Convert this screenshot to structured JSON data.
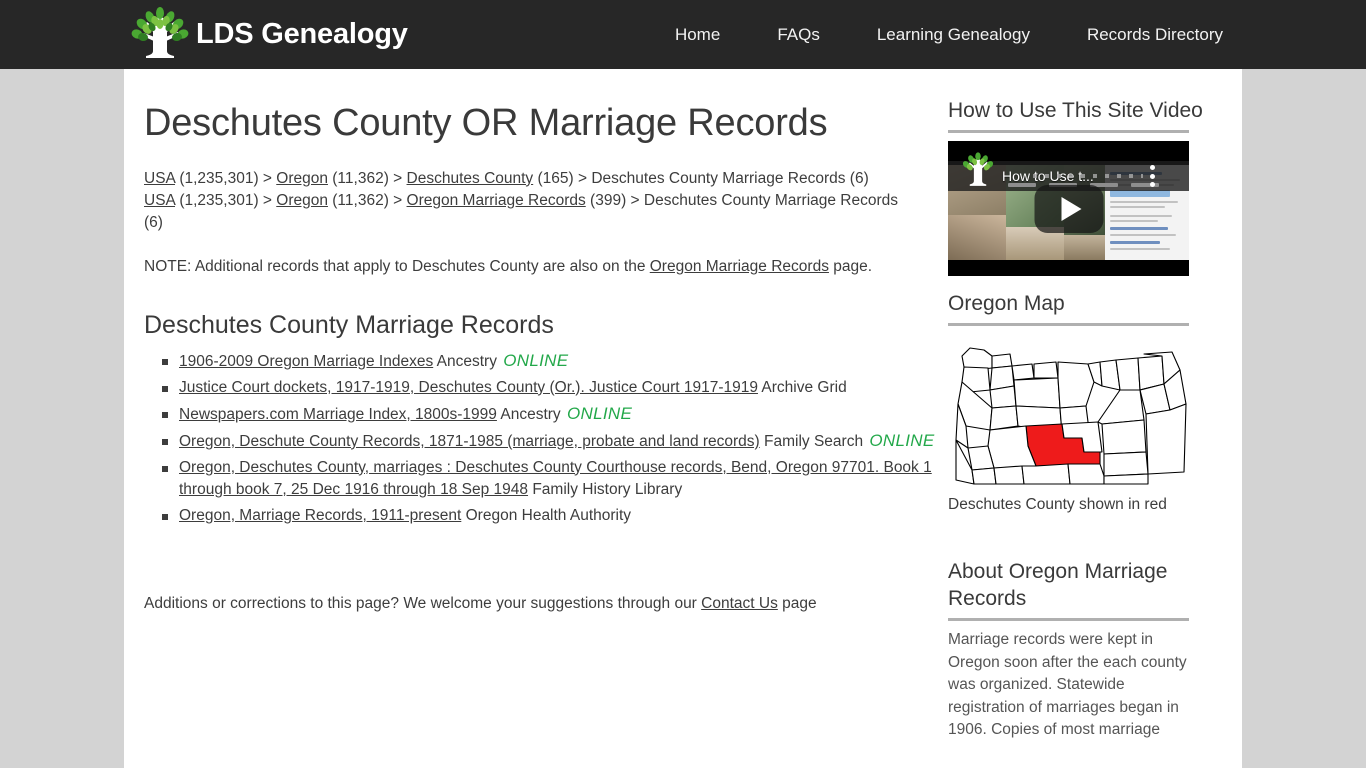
{
  "header": {
    "brand_name": "LDS Genealogy",
    "logo_icon": "family-tree-icon",
    "nav": [
      {
        "label": "Home"
      },
      {
        "label": "FAQs"
      },
      {
        "label": "Learning Genealogy"
      },
      {
        "label": "Records Directory"
      }
    ]
  },
  "main": {
    "page_title": "Deschutes County OR Marriage Records",
    "breadcrumb_1": [
      {
        "text": "USA",
        "link": true
      },
      {
        "text": " (1,235,301) > ",
        "link": false
      },
      {
        "text": "Oregon",
        "link": true
      },
      {
        "text": " (11,362) > ",
        "link": false
      },
      {
        "text": "Deschutes County",
        "link": true
      },
      {
        "text": " (165) > Deschutes County Marriage Records (6)",
        "link": false
      }
    ],
    "breadcrumb_2": [
      {
        "text": "USA",
        "link": true
      },
      {
        "text": " (1,235,301) > ",
        "link": false
      },
      {
        "text": "Oregon",
        "link": true
      },
      {
        "text": " (11,362) > ",
        "link": false
      },
      {
        "text": "Oregon Marriage Records",
        "link": true
      },
      {
        "text": " (399) > Deschutes County Marriage Records (6)",
        "link": false
      }
    ],
    "note_prefix": "NOTE: Additional records that apply to Deschutes County are also on the ",
    "note_link": "Oregon Marriage Records",
    "note_suffix": " page.",
    "section_title": "Deschutes County Marriage Records",
    "records": [
      {
        "link": "1906-2009 Oregon Marriage Indexes",
        "source": " Ancestry ",
        "badge": "ONLINE"
      },
      {
        "link": "Justice Court dockets, 1917-1919, Deschutes County (Or.). Justice Court 1917-1919",
        "source": " Archive Grid",
        "badge": ""
      },
      {
        "link": "Newspapers.com Marriage Index, 1800s-1999",
        "source": " Ancestry ",
        "badge": "ONLINE"
      },
      {
        "link": "Oregon, Deschute County Records, 1871-1985 (marriage, probate and land records)",
        "source": " Family Search ",
        "badge": "ONLINE"
      },
      {
        "link": "Oregon, Deschutes County, marriages : Deschutes County Courthouse records, Bend, Oregon 97701. Book 1 through book 7, 25 Dec 1916 through 18 Sep 1948",
        "source": " Family History Library",
        "badge": ""
      },
      {
        "link": "Oregon, Marriage Records, 1911-present",
        "source": " Oregon Health Authority",
        "badge": ""
      }
    ],
    "footer_prefix": "Additions or corrections to this page? We welcome your suggestions through our ",
    "footer_link": "Contact Us",
    "footer_suffix": " page"
  },
  "sidebar": {
    "video": {
      "heading": "How to Use This Site Video",
      "overlay_title": "How to Use t...",
      "play_icon": "play-button-icon",
      "menu_icon": "kebab-menu-icon",
      "logo_icon": "family-tree-icon"
    },
    "map": {
      "heading": "Oregon Map",
      "caption": "Deschutes County shown in red",
      "highlight_color": "#ee1b1b",
      "outline_color": "#000000"
    },
    "about": {
      "heading": "About Oregon Marriage Records",
      "body": "Marriage records were kept in Oregon soon after the each county was organized. Statewide registration of marriages began in 1906. Copies of most marriage"
    }
  },
  "colors": {
    "header_bg": "#272727",
    "page_bg": "#d3d3d3",
    "content_bg": "#ffffff",
    "text": "#3d3d3d",
    "online_green": "#23a84a",
    "rule_gray": "#b0b0b0"
  }
}
